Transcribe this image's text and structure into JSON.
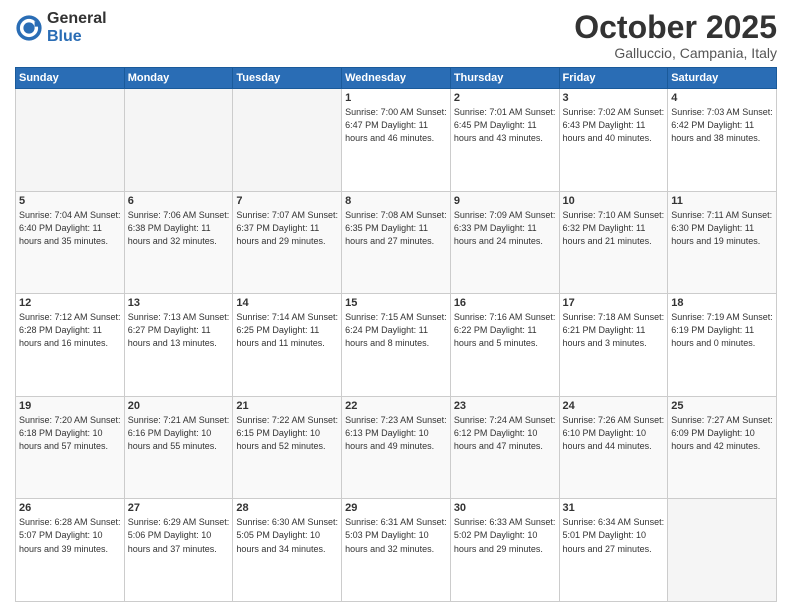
{
  "logo": {
    "general": "General",
    "blue": "Blue"
  },
  "header": {
    "month": "October 2025",
    "location": "Galluccio, Campania, Italy"
  },
  "weekdays": [
    "Sunday",
    "Monday",
    "Tuesday",
    "Wednesday",
    "Thursday",
    "Friday",
    "Saturday"
  ],
  "weeks": [
    [
      {
        "day": "",
        "info": ""
      },
      {
        "day": "",
        "info": ""
      },
      {
        "day": "",
        "info": ""
      },
      {
        "day": "1",
        "info": "Sunrise: 7:00 AM\nSunset: 6:47 PM\nDaylight: 11 hours\nand 46 minutes."
      },
      {
        "day": "2",
        "info": "Sunrise: 7:01 AM\nSunset: 6:45 PM\nDaylight: 11 hours\nand 43 minutes."
      },
      {
        "day": "3",
        "info": "Sunrise: 7:02 AM\nSunset: 6:43 PM\nDaylight: 11 hours\nand 40 minutes."
      },
      {
        "day": "4",
        "info": "Sunrise: 7:03 AM\nSunset: 6:42 PM\nDaylight: 11 hours\nand 38 minutes."
      }
    ],
    [
      {
        "day": "5",
        "info": "Sunrise: 7:04 AM\nSunset: 6:40 PM\nDaylight: 11 hours\nand 35 minutes."
      },
      {
        "day": "6",
        "info": "Sunrise: 7:06 AM\nSunset: 6:38 PM\nDaylight: 11 hours\nand 32 minutes."
      },
      {
        "day": "7",
        "info": "Sunrise: 7:07 AM\nSunset: 6:37 PM\nDaylight: 11 hours\nand 29 minutes."
      },
      {
        "day": "8",
        "info": "Sunrise: 7:08 AM\nSunset: 6:35 PM\nDaylight: 11 hours\nand 27 minutes."
      },
      {
        "day": "9",
        "info": "Sunrise: 7:09 AM\nSunset: 6:33 PM\nDaylight: 11 hours\nand 24 minutes."
      },
      {
        "day": "10",
        "info": "Sunrise: 7:10 AM\nSunset: 6:32 PM\nDaylight: 11 hours\nand 21 minutes."
      },
      {
        "day": "11",
        "info": "Sunrise: 7:11 AM\nSunset: 6:30 PM\nDaylight: 11 hours\nand 19 minutes."
      }
    ],
    [
      {
        "day": "12",
        "info": "Sunrise: 7:12 AM\nSunset: 6:28 PM\nDaylight: 11 hours\nand 16 minutes."
      },
      {
        "day": "13",
        "info": "Sunrise: 7:13 AM\nSunset: 6:27 PM\nDaylight: 11 hours\nand 13 minutes."
      },
      {
        "day": "14",
        "info": "Sunrise: 7:14 AM\nSunset: 6:25 PM\nDaylight: 11 hours\nand 11 minutes."
      },
      {
        "day": "15",
        "info": "Sunrise: 7:15 AM\nSunset: 6:24 PM\nDaylight: 11 hours\nand 8 minutes."
      },
      {
        "day": "16",
        "info": "Sunrise: 7:16 AM\nSunset: 6:22 PM\nDaylight: 11 hours\nand 5 minutes."
      },
      {
        "day": "17",
        "info": "Sunrise: 7:18 AM\nSunset: 6:21 PM\nDaylight: 11 hours\nand 3 minutes."
      },
      {
        "day": "18",
        "info": "Sunrise: 7:19 AM\nSunset: 6:19 PM\nDaylight: 11 hours\nand 0 minutes."
      }
    ],
    [
      {
        "day": "19",
        "info": "Sunrise: 7:20 AM\nSunset: 6:18 PM\nDaylight: 10 hours\nand 57 minutes."
      },
      {
        "day": "20",
        "info": "Sunrise: 7:21 AM\nSunset: 6:16 PM\nDaylight: 10 hours\nand 55 minutes."
      },
      {
        "day": "21",
        "info": "Sunrise: 7:22 AM\nSunset: 6:15 PM\nDaylight: 10 hours\nand 52 minutes."
      },
      {
        "day": "22",
        "info": "Sunrise: 7:23 AM\nSunset: 6:13 PM\nDaylight: 10 hours\nand 49 minutes."
      },
      {
        "day": "23",
        "info": "Sunrise: 7:24 AM\nSunset: 6:12 PM\nDaylight: 10 hours\nand 47 minutes."
      },
      {
        "day": "24",
        "info": "Sunrise: 7:26 AM\nSunset: 6:10 PM\nDaylight: 10 hours\nand 44 minutes."
      },
      {
        "day": "25",
        "info": "Sunrise: 7:27 AM\nSunset: 6:09 PM\nDaylight: 10 hours\nand 42 minutes."
      }
    ],
    [
      {
        "day": "26",
        "info": "Sunrise: 6:28 AM\nSunset: 5:07 PM\nDaylight: 10 hours\nand 39 minutes."
      },
      {
        "day": "27",
        "info": "Sunrise: 6:29 AM\nSunset: 5:06 PM\nDaylight: 10 hours\nand 37 minutes."
      },
      {
        "day": "28",
        "info": "Sunrise: 6:30 AM\nSunset: 5:05 PM\nDaylight: 10 hours\nand 34 minutes."
      },
      {
        "day": "29",
        "info": "Sunrise: 6:31 AM\nSunset: 5:03 PM\nDaylight: 10 hours\nand 32 minutes."
      },
      {
        "day": "30",
        "info": "Sunrise: 6:33 AM\nSunset: 5:02 PM\nDaylight: 10 hours\nand 29 minutes."
      },
      {
        "day": "31",
        "info": "Sunrise: 6:34 AM\nSunset: 5:01 PM\nDaylight: 10 hours\nand 27 minutes."
      },
      {
        "day": "",
        "info": ""
      }
    ]
  ]
}
